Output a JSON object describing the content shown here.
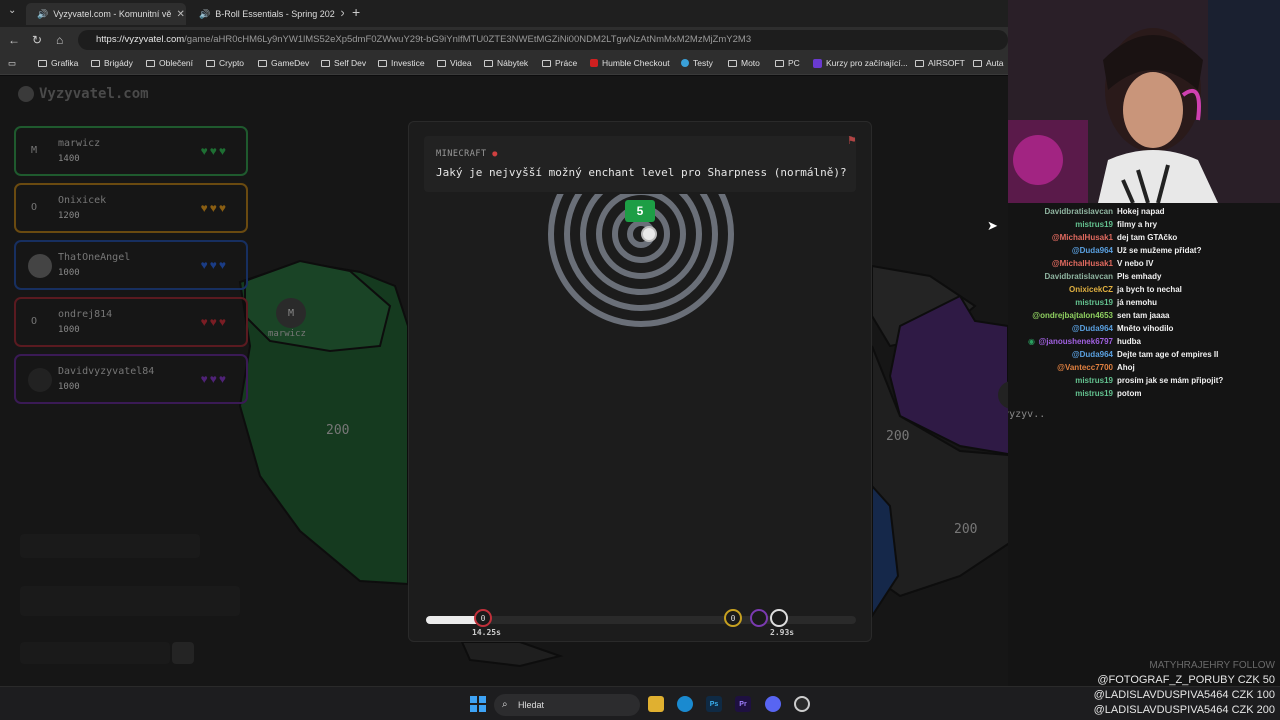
{
  "browser": {
    "tabs": [
      {
        "title": "Vyzyvatel.com - Komunitní vě",
        "active": true
      },
      {
        "title": "B-Roll Essentials - Spring 202",
        "active": false
      }
    ],
    "url_domain": "https://vyzyvatel.com",
    "url_path": "/game/aHR0cHM6Ly9nYW1lMS52eXp5dmF0ZWwuY29t-bG9iYnlfMTU0ZTE3NWEtMGZiNi00NDM2LTgwNzAtNmMxM2MzMjZmY2M3",
    "bookmarks": [
      "Grafika",
      "Brigády",
      "Oblečení",
      "Crypto",
      "GameDev",
      "Self Dev",
      "Investice",
      "Videa",
      "Nábytek",
      "Práce",
      "Humble Checkout",
      "Testy",
      "Moto",
      "PC",
      "Kurzy pro začínající...",
      "AIRSOFT",
      "Auta"
    ]
  },
  "site": {
    "logo": "Vyzyvatel.com"
  },
  "players": [
    {
      "initial": "M",
      "name": "marwicz",
      "score": "1400",
      "color": "#1f7a3a",
      "heart": "#1e8f3e"
    },
    {
      "initial": "O",
      "name": "Onixicek",
      "score": "1200",
      "color": "#8a5a10",
      "heart": "#b57a14"
    },
    {
      "initial": "",
      "name": "ThatOneAngel",
      "score": "1000",
      "color": "#1c3a7a",
      "heart": "#2050b0"
    },
    {
      "initial": "O",
      "name": "ondrej814",
      "score": "1000",
      "color": "#7a1f26",
      "heart": "#a0252d"
    },
    {
      "initial": "",
      "name": "Davidvyzyvatel84",
      "score": "1000",
      "color": "#4a1f6a",
      "heart": "#6a2d99"
    }
  ],
  "map": {
    "labels": [
      {
        "text": "marwicz"
      },
      {
        "text": "200"
      },
      {
        "text": "200"
      },
      {
        "text": "200"
      },
      {
        "text": "Davidvyzyv.."
      }
    ],
    "marker_initial": "M"
  },
  "question": {
    "category": "MINECRAFT",
    "text": "Jaký je nejvyšší možný enchant level pro Sharpness (normálně)?",
    "answer_badge": "5"
  },
  "timeline": {
    "progress": 0.13,
    "markers": [
      {
        "label": "0",
        "time": "14.25s",
        "color": "#c0303a"
      },
      {
        "label": "0",
        "time": "",
        "color": "#c6a020"
      },
      {
        "label": "",
        "time": "",
        "color": "#7a3ab0"
      },
      {
        "label": "",
        "time": "2.93s",
        "color": "#dddddd"
      }
    ]
  },
  "chat": [
    {
      "user": "Davidbratislavcan",
      "msg": "Hokej napad",
      "color": "#8fb4a0"
    },
    {
      "user": "mistrus19",
      "msg": "filmy a hry",
      "color": "#63c18f"
    },
    {
      "user": "@MichalHusak1",
      "msg": "dej tam GTAčko",
      "color": "#e06a5f"
    },
    {
      "user": "@Duda964",
      "msg": "Už se mužeme přidat?",
      "color": "#5aa0e0"
    },
    {
      "user": "@MichalHusak1",
      "msg": "V nebo IV",
      "color": "#e06a5f"
    },
    {
      "user": "Davidbratislavcan",
      "msg": "Pls emhady",
      "color": "#8fb4a0"
    },
    {
      "user": "OnixicekCZ",
      "msg": "ja bych to nechal",
      "color": "#e0b040"
    },
    {
      "user": "mistrus19",
      "msg": "já nemohu",
      "color": "#63c18f"
    },
    {
      "user": "@ondrejbajtalon4653",
      "msg": "sen tam jaaaa",
      "color": "#8fd060"
    },
    {
      "user": "@Duda964",
      "msg": "Mněto vihodilo",
      "color": "#5aa0e0"
    },
    {
      "user": "@janoushenek6797",
      "msg": "hudba",
      "color": "#a060e0"
    },
    {
      "user": "@Duda964",
      "msg": "Dejte tam age of empires II",
      "color": "#5aa0e0"
    },
    {
      "user": "@Vantecc7700",
      "msg": "Ahoj",
      "color": "#e08040"
    },
    {
      "user": "mistrus19",
      "msg": "prosím jak se mám připojit?",
      "color": "#63c18f"
    },
    {
      "user": "mistrus19",
      "msg": "potom",
      "color": "#63c18f"
    }
  ],
  "overlay": {
    "follow": "MATYHRAJEHRY FOLLOW",
    "donations": [
      "@FOTOGRAF_Z_PORUBY CZK 50",
      "@LADISLAVDUSPIVA5464 CZK 100",
      "@LADISLAVDUSPIVA5464 CZK 200"
    ]
  },
  "taskbar": {
    "search_placeholder": "Hledat"
  }
}
